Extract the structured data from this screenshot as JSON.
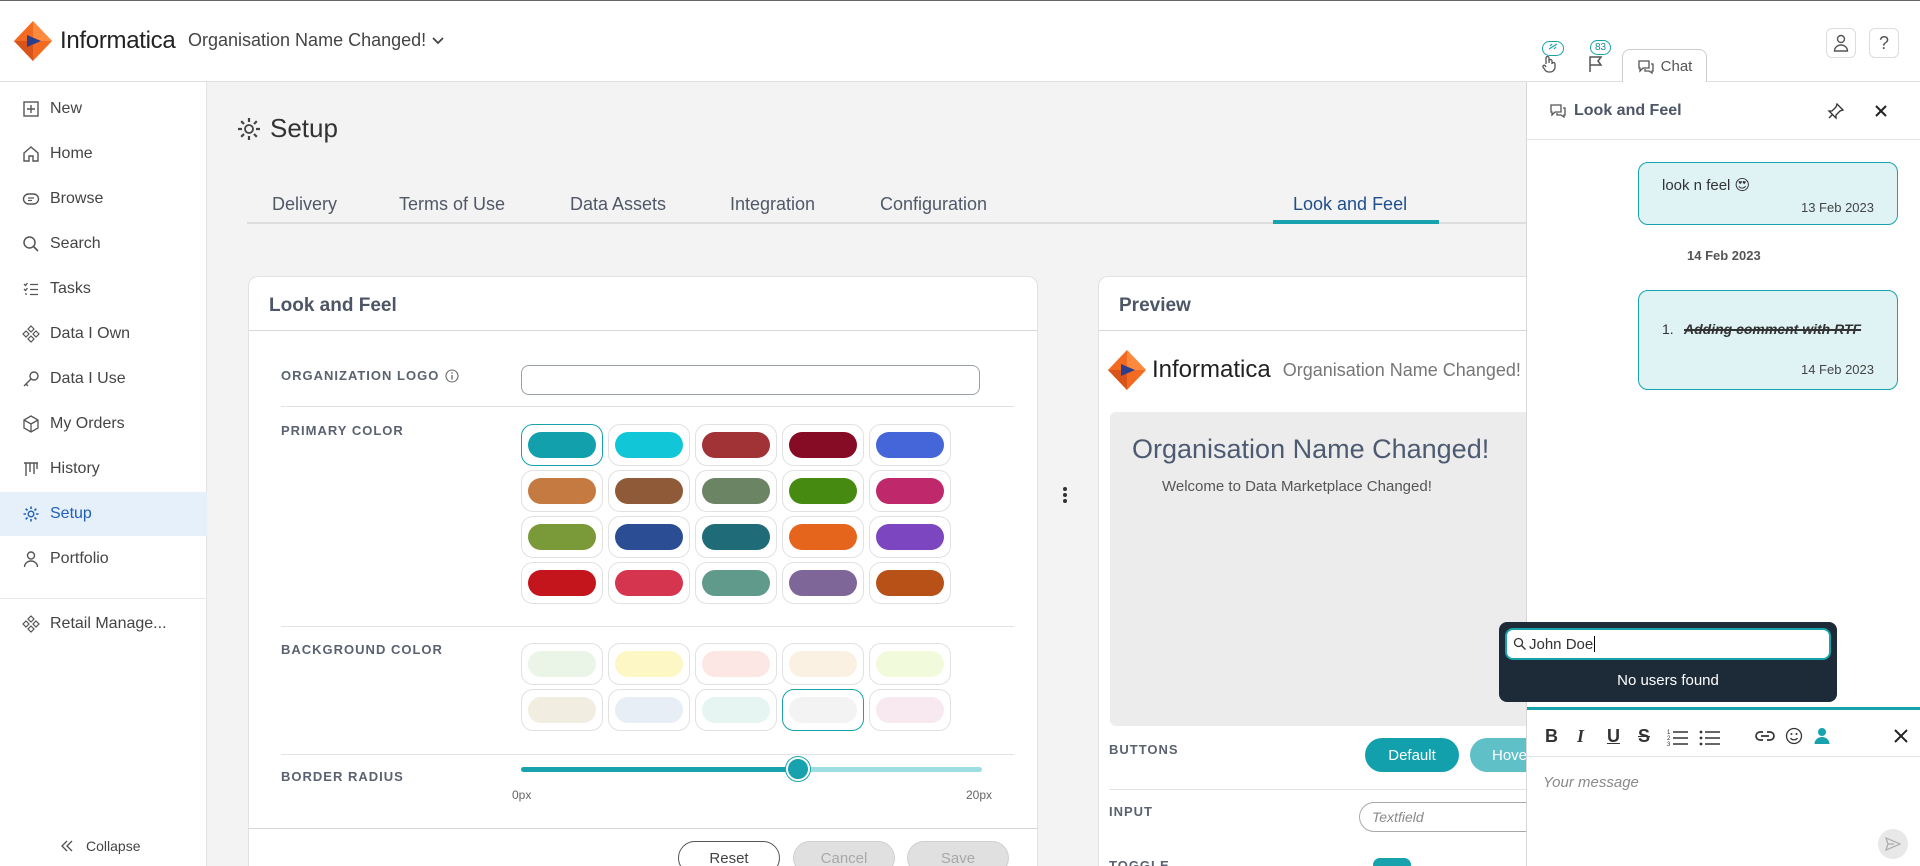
{
  "brand": {
    "logo_text": "Informatica",
    "org_name": "Organisation Name Changed!",
    "accent": "#17a2ad"
  },
  "topbar": {
    "badge_pin": "̸",
    "badge_flag": "83",
    "chat_tab": "Chat"
  },
  "sidebar": {
    "items": [
      {
        "label": "New",
        "icon": "plus-box-icon"
      },
      {
        "label": "Home",
        "icon": "home-icon"
      },
      {
        "label": "Browse",
        "icon": "browse-icon"
      },
      {
        "label": "Search",
        "icon": "search-icon"
      },
      {
        "label": "Tasks",
        "icon": "tasks-icon"
      },
      {
        "label": "Data I Own",
        "icon": "data-own-icon"
      },
      {
        "label": "Data I Use",
        "icon": "key-icon"
      },
      {
        "label": "My Orders",
        "icon": "box-icon"
      },
      {
        "label": "History",
        "icon": "history-icon"
      },
      {
        "label": "Setup",
        "icon": "gear-icon"
      },
      {
        "label": "Portfolio",
        "icon": "person-icon"
      },
      {
        "label": "Retail Manage...",
        "icon": "data-own-icon"
      }
    ],
    "collapse_label": "Collapse"
  },
  "main": {
    "title": "Setup",
    "tabs": [
      "Delivery",
      "Terms of Use",
      "Data Assets",
      "Integration",
      "Configuration",
      "Look and Feel"
    ],
    "active_tab": "Look and Feel"
  },
  "look_feel": {
    "title": "Look and Feel",
    "org_logo_label": "ORGANIZATION LOGO",
    "primary_color_label": "PRIMARY COLOR",
    "primary_colors": [
      "#12a0ad",
      "#11c6d6",
      "#a13236",
      "#860c26",
      "#4466d8",
      "#c47a40",
      "#8e5a38",
      "#6b8463",
      "#478a12",
      "#c0286c",
      "#7a9a3a",
      "#2a4d94",
      "#1f6b78",
      "#e6651c",
      "#7b46c0",
      "#c4151c",
      "#d6354f",
      "#5f9a8a",
      "#7e6698",
      "#b85118"
    ],
    "primary_selected": 0,
    "background_color_label": "BACKGROUND COLOR",
    "background_colors": [
      "#eaf5e8",
      "#fdf7c6",
      "#fce7e5",
      "#fbf1e3",
      "#f1fadb",
      "#f1ede1",
      "#e7eef5",
      "#e6f5f2",
      "#f3f3f3",
      "#f8e9f1"
    ],
    "background_selected": 8,
    "border_radius_label": "BORDER RADIUS",
    "border_radius_value": 12,
    "border_radius_max": 20,
    "slider_min_label": "0px",
    "slider_max_label": "20px",
    "reset_label": "Reset",
    "cancel_label": "Cancel",
    "save_label": "Save"
  },
  "preview": {
    "title": "Preview",
    "hero_title": "Organisation Name Changed!",
    "hero_subtitle": "Welcome to Data Marketplace Changed!",
    "buttons_label": "BUTTONS",
    "default_button": "Default",
    "hover_button": "Hove",
    "input_label": "INPUT",
    "input_placeholder": "Textfield",
    "toggle_label": "TOGGLE"
  },
  "chat": {
    "title": "Look and Feel",
    "messages": [
      {
        "text": "look n feel 😍",
        "date": "13 Feb 2023"
      },
      {
        "list_number": "1.",
        "text": "Adding comment with RTF",
        "date": "14 Feb 2023"
      }
    ],
    "date_divider": "14 Feb 2023",
    "message_placeholder": "Your message",
    "mention": {
      "query": "John Doe",
      "no_results": "No users found"
    }
  }
}
